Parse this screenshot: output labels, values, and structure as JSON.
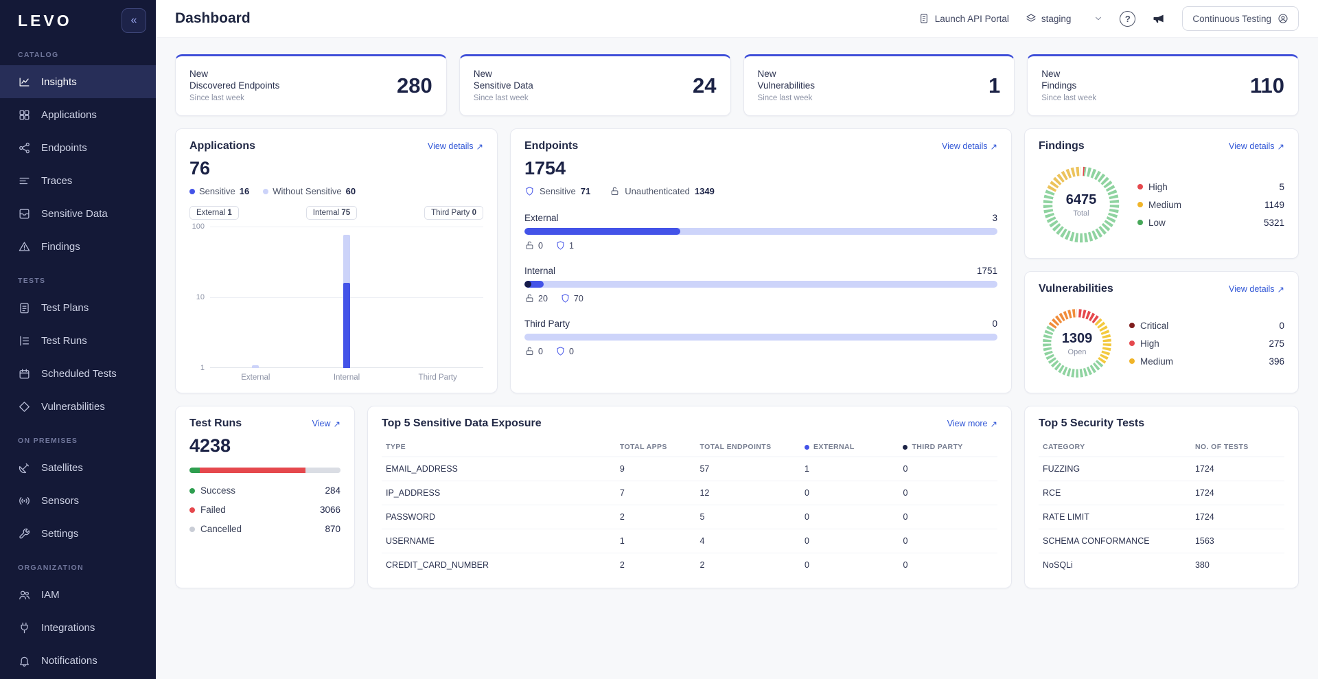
{
  "sidebar": {
    "logo": "LEVO",
    "collapse_glyph": "«",
    "sections": [
      {
        "label": "CATALOG",
        "items": [
          {
            "label": "Insights"
          },
          {
            "label": "Applications"
          },
          {
            "label": "Endpoints"
          },
          {
            "label": "Traces"
          },
          {
            "label": "Sensitive Data"
          },
          {
            "label": "Findings"
          }
        ]
      },
      {
        "label": "TESTS",
        "items": [
          {
            "label": "Test Plans"
          },
          {
            "label": "Test Runs"
          },
          {
            "label": "Scheduled Tests"
          },
          {
            "label": "Vulnerabilities"
          }
        ]
      },
      {
        "label": "ON PREMISES",
        "items": [
          {
            "label": "Satellites"
          },
          {
            "label": "Sensors"
          },
          {
            "label": "Settings"
          }
        ]
      },
      {
        "label": "ORGANIZATION",
        "items": [
          {
            "label": "IAM"
          },
          {
            "label": "Integrations"
          },
          {
            "label": "Notifications"
          }
        ]
      }
    ]
  },
  "header": {
    "title": "Dashboard",
    "api_portal_label": "Launch API Portal",
    "environment": "staging",
    "help_glyph": "?",
    "continuous_testing_label": "Continuous Testing"
  },
  "stats": [
    {
      "title_line1": "New",
      "title_line2": "Discovered Endpoints",
      "subtitle": "Since last week",
      "value": "280"
    },
    {
      "title_line1": "New",
      "title_line2": "Sensitive Data",
      "subtitle": "Since last week",
      "value": "24"
    },
    {
      "title_line1": "New",
      "title_line2": "Vulnerabilities",
      "subtitle": "Since last week",
      "value": "1"
    },
    {
      "title_line1": "New",
      "title_line2": "Findings",
      "subtitle": "Since last week",
      "value": "110"
    }
  ],
  "accent": {
    "primary_blue": "#4353e8",
    "lavender": "#ccd3f9",
    "navy": "#151b4a",
    "link_blue": "#3056d6",
    "card_top_blue": "#3f4fd8"
  },
  "applications": {
    "title": "Applications",
    "link": "View details",
    "total": "76",
    "legend": [
      {
        "label": "Sensitive",
        "value": "16",
        "color": "#4353e8"
      },
      {
        "label": "Without Sensitive",
        "value": "60",
        "color": "#ccd3f9"
      }
    ],
    "chips": [
      {
        "label": "External",
        "value": "1"
      },
      {
        "label": "Internal",
        "value": "75"
      },
      {
        "label": "Third Party",
        "value": "0"
      }
    ],
    "chart": {
      "type": "bar",
      "scale": "log",
      "y_ticks": [
        "100",
        "10",
        "1"
      ],
      "categories": [
        "External",
        "Internal",
        "Third Party"
      ],
      "series": [
        {
          "name": "Total",
          "values": [
            1,
            75,
            0
          ]
        },
        {
          "name": "Sensitive",
          "values": [
            0,
            16,
            0
          ]
        }
      ],
      "bar_heights": [
        {
          "light": 2,
          "dark": 0
        },
        {
          "light": 94,
          "dark": 60
        },
        {
          "light": 0,
          "dark": 0
        }
      ]
    }
  },
  "endpoints": {
    "title": "Endpoints",
    "link": "View details",
    "total": "1754",
    "legend_sensitive_label": "Sensitive",
    "legend_sensitive_value": "71",
    "legend_unauth_label": "Unauthenticated",
    "legend_unauth_value": "1349",
    "groups": [
      {
        "label": "External",
        "value": "3",
        "fill_pct": 33,
        "dark_pct": 0,
        "unauth": "0",
        "sensitive": "1"
      },
      {
        "label": "Internal",
        "value": "1751",
        "fill_pct": 4,
        "dark_pct": 1.5,
        "unauth": "20",
        "sensitive": "70"
      },
      {
        "label": "Third Party",
        "value": "0",
        "fill_pct": 0,
        "dark_pct": 0,
        "unauth": "0",
        "sensitive": "0"
      }
    ]
  },
  "findings": {
    "title": "Findings",
    "link": "View details",
    "total": "6475",
    "total_label": "Total",
    "legend": [
      {
        "label": "High",
        "value": "5",
        "color": "#e5484d"
      },
      {
        "label": "Medium",
        "value": "1149",
        "color": "#f0b429"
      },
      {
        "label": "Low",
        "value": "5321",
        "color": "#46a758"
      }
    ],
    "ring": [
      {
        "color": "#e5484d",
        "pct": 1.5
      },
      {
        "color": "#8fd3a0",
        "pct": 80.5
      },
      {
        "color": "#ecc35c",
        "pct": 18
      }
    ]
  },
  "vulnerabilities": {
    "title": "Vulnerabilities",
    "link": "View details",
    "total": "1309",
    "total_label": "Open",
    "legend": [
      {
        "label": "Critical",
        "value": "0",
        "color": "#7f1d1d"
      },
      {
        "label": "High",
        "value": "275",
        "color": "#e5484d"
      },
      {
        "label": "Medium",
        "value": "396",
        "color": "#f0b429"
      }
    ],
    "ring": [
      {
        "color": "#e5484d",
        "pct": 12
      },
      {
        "color": "#f3c93f",
        "pct": 24
      },
      {
        "color": "#8fd3a0",
        "pct": 48
      },
      {
        "color": "#f08c3a",
        "pct": 16
      }
    ]
  },
  "test_runs": {
    "title": "Test Runs",
    "link": "View",
    "total": "4238",
    "legend": [
      {
        "label": "Success",
        "value": "284",
        "color": "#2e9e4f"
      },
      {
        "label": "Failed",
        "value": "3066",
        "color": "#e5484d"
      },
      {
        "label": "Cancelled",
        "value": "870",
        "color": "#c9cdd6"
      }
    ],
    "bar": [
      {
        "color": "#2e9e4f",
        "pct": 7
      },
      {
        "color": "#e5484d",
        "pct": 70
      },
      {
        "color": "#dadde4",
        "pct": 23
      }
    ]
  },
  "sensitive_exposure": {
    "title": "Top 5 Sensitive Data Exposure",
    "link": "View more",
    "columns": [
      "TYPE",
      "TOTAL APPS",
      "TOTAL ENDPOINTS",
      "EXTERNAL",
      "THIRD PARTY"
    ],
    "external_dot": "#4353e8",
    "third_party_dot": "#1c2346",
    "rows": [
      {
        "type": "EMAIL_ADDRESS",
        "apps": "9",
        "endpoints": "57",
        "external": "1",
        "third_party": "0"
      },
      {
        "type": "IP_ADDRESS",
        "apps": "7",
        "endpoints": "12",
        "external": "0",
        "third_party": "0"
      },
      {
        "type": "PASSWORD",
        "apps": "2",
        "endpoints": "5",
        "external": "0",
        "third_party": "0"
      },
      {
        "type": "USERNAME",
        "apps": "1",
        "endpoints": "4",
        "external": "0",
        "third_party": "0"
      },
      {
        "type": "CREDIT_CARD_NUMBER",
        "apps": "2",
        "endpoints": "2",
        "external": "0",
        "third_party": "0"
      }
    ]
  },
  "security_tests": {
    "title": "Top 5 Security Tests",
    "columns": [
      "CATEGORY",
      "NO. OF TESTS"
    ],
    "rows": [
      {
        "category": "FUZZING",
        "tests": "1724"
      },
      {
        "category": "RCE",
        "tests": "1724"
      },
      {
        "category": "RATE LIMIT",
        "tests": "1724"
      },
      {
        "category": "SCHEMA CONFORMANCE",
        "tests": "1563"
      },
      {
        "category": "NoSQLi",
        "tests": "380"
      }
    ]
  }
}
